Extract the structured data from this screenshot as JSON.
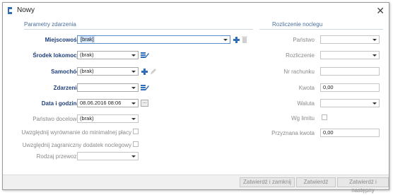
{
  "window": {
    "title": "Nowy"
  },
  "left": {
    "section_title": "Parametry zdarzenia",
    "fields": {
      "miejscowosc": {
        "label": "Miejscowość",
        "value": "[brak]"
      },
      "srodek": {
        "label": "Środek lokomocji",
        "value": "(brak)"
      },
      "samochod": {
        "label": "Samochód",
        "value": "(brak)"
      },
      "zdarzenie": {
        "label": "Zdarzenie",
        "value": ""
      },
      "data": {
        "label": "Data i godzina",
        "value": "08.06.2016 08:06",
        "button": "..."
      },
      "panstwo_docelowe": {
        "label": "Państwo docelowe",
        "value": "(brak)"
      },
      "wyrownanie": {
        "label": "Uwzględnij wyrównanie do minimalnej płacy"
      },
      "dodatek": {
        "label": "Uwzględnij zagraniczny dodatek noclegowy"
      },
      "rodzaj": {
        "label": "Rodzaj przewozu",
        "value": ""
      }
    }
  },
  "right": {
    "section_title": "Rozliczenie noclegu",
    "fields": {
      "panstwo": {
        "label": "Państwo",
        "value": ""
      },
      "rozliczenie": {
        "label": "Rozliczenie",
        "value": ""
      },
      "nr_rachunku": {
        "label": "Nr rachunku",
        "value": ""
      },
      "kwota": {
        "label": "Kwota",
        "value": "0,00"
      },
      "waluta": {
        "label": "Waluta",
        "value": ""
      },
      "wg_limitu": {
        "label": "Wg limitu"
      },
      "przyznana": {
        "label": "Przyznana kwota",
        "value": "0,00"
      }
    }
  },
  "footer": {
    "approve_close": "Zatwierdź i zamknij",
    "approve": "Zatwierdź",
    "approve_next": "Zatwierdź i następny"
  }
}
